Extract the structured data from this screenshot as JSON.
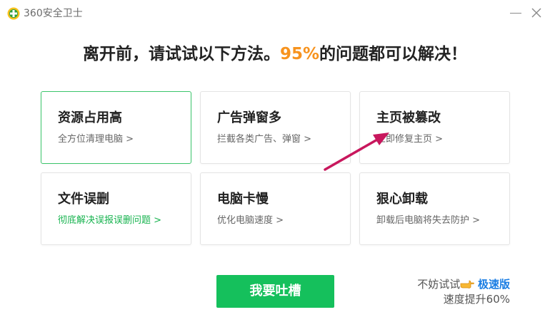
{
  "app": {
    "name": "360安全卫士",
    "icon": "360-logo-icon",
    "brand_color": "#f7c21c",
    "accent_green": "#15c05c"
  },
  "headline": {
    "before": "离开前，请试试以下方法。",
    "highlight": "95%",
    "after": "的问题都可以解决！",
    "highlight_color": "#f7931e"
  },
  "cards": [
    {
      "title": "资源占用高",
      "desc": "全方位清理电脑 >"
    },
    {
      "title": "广告弹窗多",
      "desc": "拦截各类广告、弹窗 >"
    },
    {
      "title": "主页被篡改",
      "desc": "立即修复主页 >"
    },
    {
      "title": "文件误删",
      "desc": "彻底解决误报误删问题 >"
    },
    {
      "title": "电脑卡慢",
      "desc": "优化电脑速度 >"
    },
    {
      "title": "狠心卸载",
      "desc": "卸载后电脑将失去防护 >"
    }
  ],
  "cta": {
    "label": "我要吐槽"
  },
  "promo": {
    "try_text": "不妨试试",
    "hand_icon": "pointing-hand-icon",
    "fast_version": "极速版",
    "speedup": "速度提升60%",
    "link_color": "#1a7de3"
  },
  "annotation": {
    "arrow_icon": "pointer-arrow-icon",
    "arrow_color": "#c8175d"
  }
}
